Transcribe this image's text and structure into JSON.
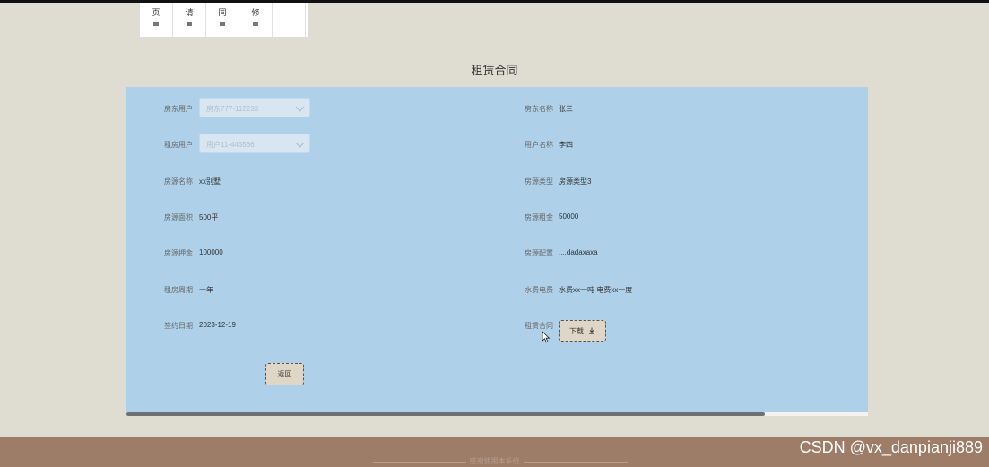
{
  "nav": {
    "items": [
      {
        "label": "页"
      },
      {
        "label": "请"
      },
      {
        "label": "同"
      },
      {
        "label": "修"
      },
      {
        "label": ""
      }
    ]
  },
  "page": {
    "title": "租赁合同"
  },
  "form": {
    "landlord_user": {
      "label": "房东用户",
      "value": "房东777-112233"
    },
    "landlord_name": {
      "label": "房东名称",
      "value": "张三"
    },
    "tenant_user": {
      "label": "租房用户",
      "value": "用户11-445566"
    },
    "user_name": {
      "label": "用户名称",
      "value": "李四"
    },
    "house_name": {
      "label": "房源名称",
      "value": "xx别墅"
    },
    "house_type": {
      "label": "房源类型",
      "value": "房源类型3"
    },
    "house_area": {
      "label": "房源面积",
      "value": "500平"
    },
    "house_rent": {
      "label": "房源租金",
      "value": "50000"
    },
    "house_deposit": {
      "label": "房源押金",
      "value": "100000"
    },
    "house_config": {
      "label": "房源配置",
      "value": "....dadaxaxa"
    },
    "rent_period": {
      "label": "租房周期",
      "value": "一年"
    },
    "utility_fee": {
      "label": "水费电费",
      "value": "水费xx一吨 电费xx一度"
    },
    "sign_date": {
      "label": "签约日期",
      "value": "2023-12-19"
    },
    "contract": {
      "label": "租赁合同",
      "download_label": "下载"
    },
    "back_label": "返回"
  },
  "footer": {
    "text": "感谢使用本系统"
  },
  "watermark": "CSDN @vx_danpianji889"
}
